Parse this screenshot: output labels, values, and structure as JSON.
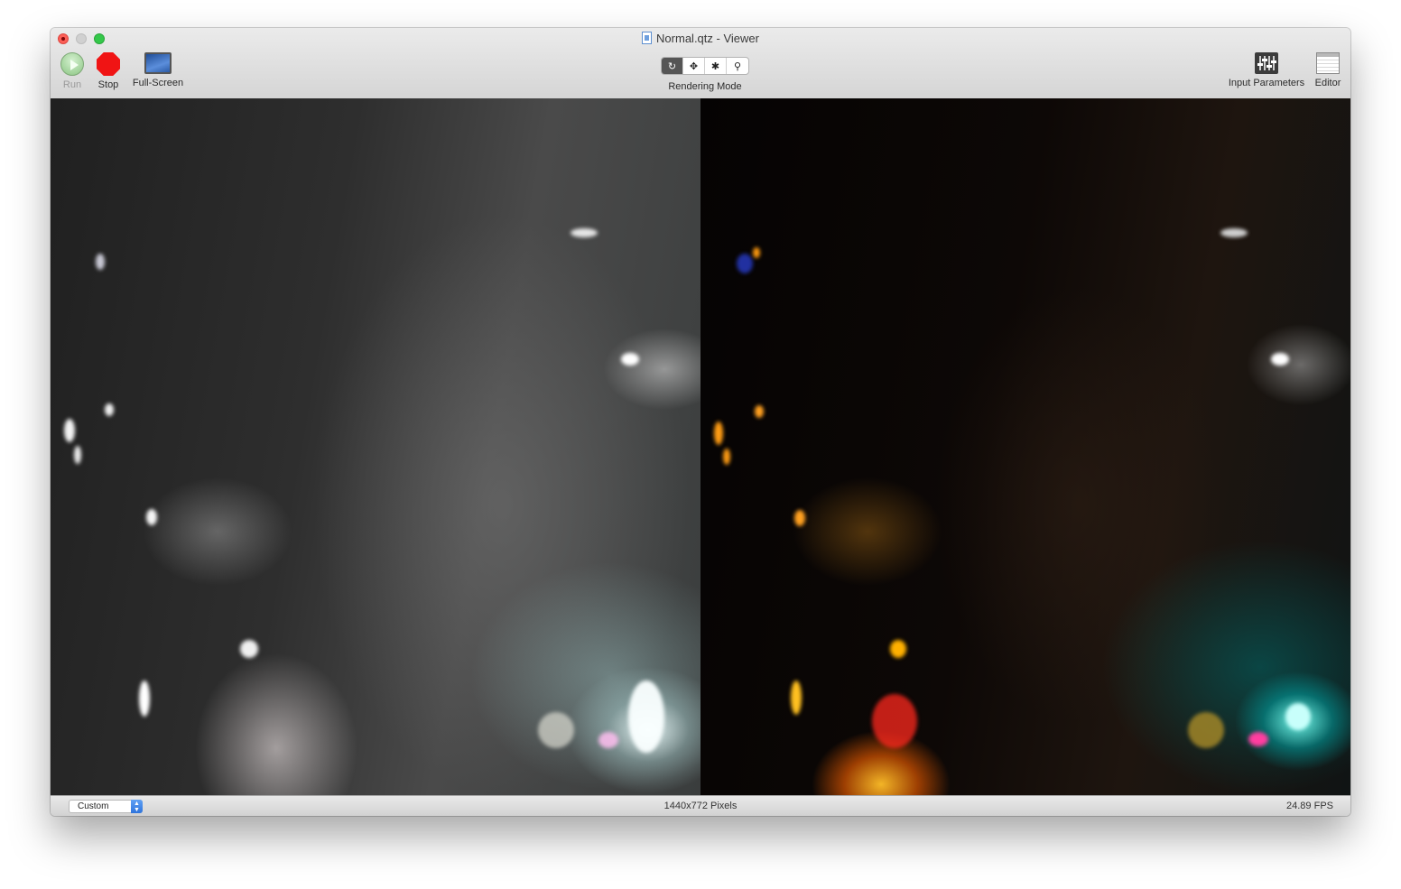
{
  "window": {
    "title": "Normal.qtz - Viewer"
  },
  "toolbar": {
    "run_label": "Run",
    "stop_label": "Stop",
    "fullscreen_label": "Full-Screen",
    "rendering_mode_label": "Rendering Mode",
    "rendering_modes": [
      {
        "icon": "rotate-icon",
        "glyph": "↻",
        "active": true
      },
      {
        "icon": "move-icon",
        "glyph": "✥",
        "active": false
      },
      {
        "icon": "bug-icon",
        "glyph": "✱",
        "active": false
      },
      {
        "icon": "magnifier-icon",
        "glyph": "⚲",
        "active": false
      }
    ],
    "input_parameters_label": "Input Parameters",
    "editor_label": "Editor"
  },
  "viewer": {
    "description_panes": [
      "left-grayscale-render",
      "right-color-render"
    ]
  },
  "statusbar": {
    "size_select_value": "Custom",
    "resolution": "1440x772 Pixels",
    "fps": "24.89 FPS"
  },
  "colors": {
    "close": "#fc5f57",
    "zoom": "#34c84a",
    "stop": "#f01414",
    "select_accent": "#2e73db"
  }
}
